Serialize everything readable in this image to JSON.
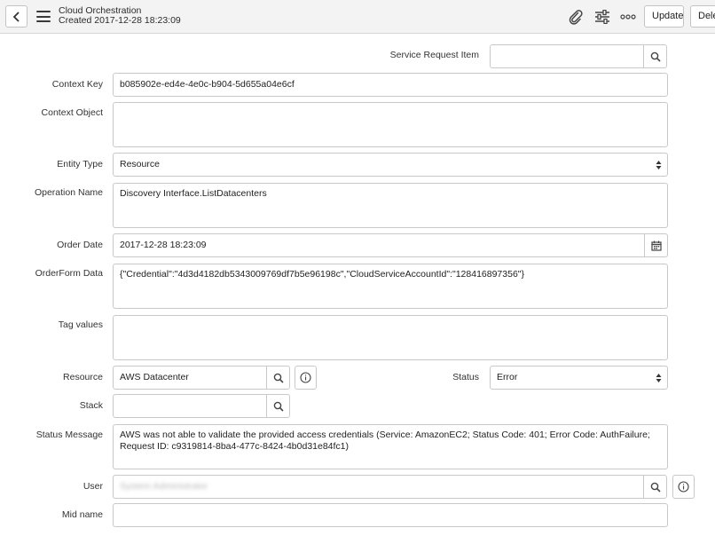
{
  "header": {
    "title": "Cloud Orchestration",
    "subtitle": "Created 2017-12-28 18:23:09",
    "update_label": "Update",
    "delete_label": "Dele",
    "icons": [
      "back-icon",
      "hamburger-icon",
      "paperclip-icon",
      "sliders-icon",
      "more-icon"
    ]
  },
  "form": {
    "service_request_item": {
      "label": "Service Request Item",
      "value": ""
    },
    "context_key": {
      "label": "Context Key",
      "value": "b085902e-ed4e-4e0c-b904-5d655a04e6cf"
    },
    "context_object": {
      "label": "Context Object",
      "value": ""
    },
    "entity_type": {
      "label": "Entity Type",
      "value": "Resource"
    },
    "operation_name": {
      "label": "Operation Name",
      "value": "Discovery Interface.ListDatacenters"
    },
    "order_date": {
      "label": "Order Date",
      "value": "2017-12-28 18:23:09"
    },
    "orderform_data": {
      "label": "OrderForm Data",
      "value": "{\"Credential\":\"4d3d4182db5343009769df7b5e96198c\",\"CloudServiceAccountId\":\"128416897356\"}"
    },
    "tag_values": {
      "label": "Tag values",
      "value": ""
    },
    "resource": {
      "label": "Resource",
      "value": "AWS Datacenter"
    },
    "status": {
      "label": "Status",
      "value": "Error"
    },
    "stack": {
      "label": "Stack",
      "value": ""
    },
    "status_message": {
      "label": "Status Message",
      "value": "AWS was not able to validate the provided access credentials (Service: AmazonEC2; Status Code: 401; Error Code: AuthFailure; Request ID: c9319814-8ba4-477c-8424-4b0d31e84fc1)"
    },
    "user": {
      "label": "User",
      "value": "System Administrator"
    },
    "mid_name": {
      "label": "Mid name",
      "value": ""
    }
  },
  "colors": {
    "border": "#c9c9c9",
    "header_bg": "#f3f3f3",
    "text": "#2e2e2e"
  }
}
